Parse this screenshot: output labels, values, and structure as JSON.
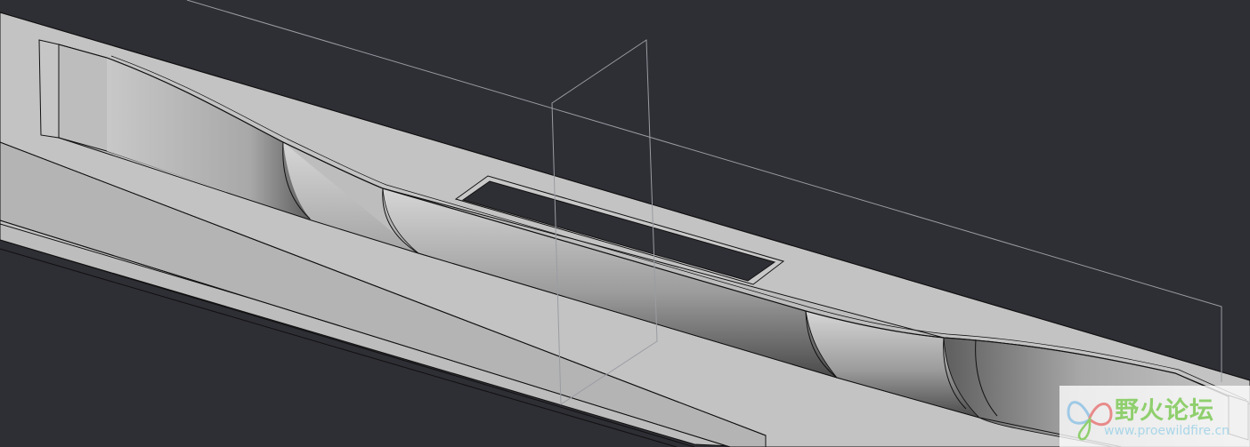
{
  "viewport": {
    "background": "#2e2e35",
    "model_light": "#c4c4c4",
    "model_mid": "#b3b3b3",
    "model_dark": "#5a5a5a",
    "edge_color": "#111111",
    "datum_color": "#9a9ca2"
  },
  "watermark": {
    "title": "野火论坛",
    "url": "www.proewildfire.cn",
    "title_color": "#8fcf6d",
    "url_color": "#a9d6e8",
    "logo_colors": [
      "#9fc9e6",
      "#e88a8a",
      "#8fcf6d"
    ],
    "logo_icon": "butterfly-icon"
  }
}
